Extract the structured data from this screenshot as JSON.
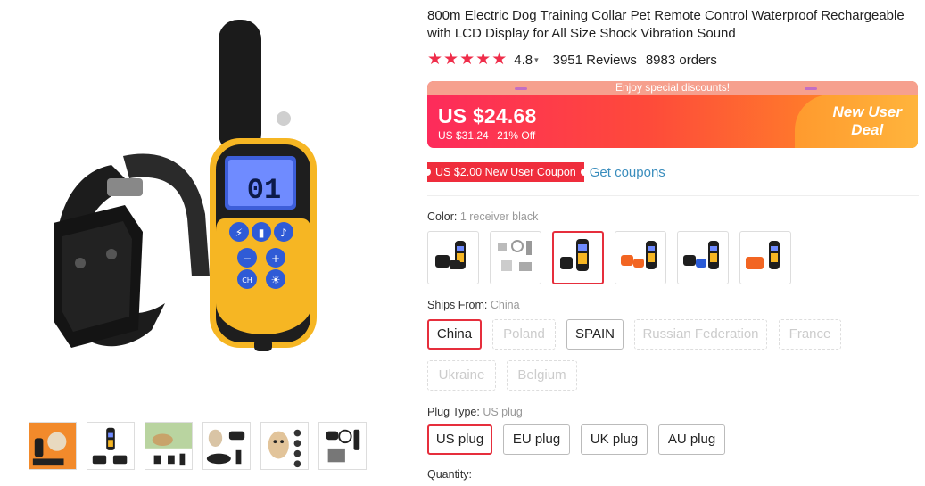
{
  "product": {
    "title": "800m Electric Dog Training Collar Pet Remote Control Waterproof Rechargeable with LCD Display for All Size Shock Vibration Sound",
    "rating": "4.8",
    "reviews": "3951 Reviews",
    "orders": "8983 orders",
    "stars": 5,
    "lcd_reading": "01"
  },
  "price": {
    "promo_strip": "Enjoy special discounts!",
    "current": "US $24.68",
    "original": "US $31.24",
    "discount": "21% Off",
    "deal_line1": "New User",
    "deal_line2": "Deal"
  },
  "coupon": {
    "badge": "US $2.00 New User Coupon",
    "link": "Get coupons"
  },
  "color": {
    "label": "Color:",
    "selected": "1 receiver black",
    "options": [
      "black-1",
      "accessories",
      "black-2",
      "orange-2",
      "blue-2",
      "orange-single"
    ]
  },
  "ships_from": {
    "label": "Ships From:",
    "selected": "China",
    "options": [
      "China",
      "Poland",
      "SPAIN",
      "Russian Federation",
      "France",
      "Ukraine",
      "Belgium"
    ]
  },
  "plug": {
    "label": "Plug Type:",
    "selected": "US plug",
    "options": [
      "US plug",
      "EU plug",
      "UK plug",
      "AU plug"
    ]
  },
  "quantity": {
    "label": "Quantity:"
  },
  "colors": {
    "accent": "#e62e3c",
    "star": "#ef2d4a",
    "link": "#3a8dbd",
    "device_yellow": "#f6b623"
  }
}
